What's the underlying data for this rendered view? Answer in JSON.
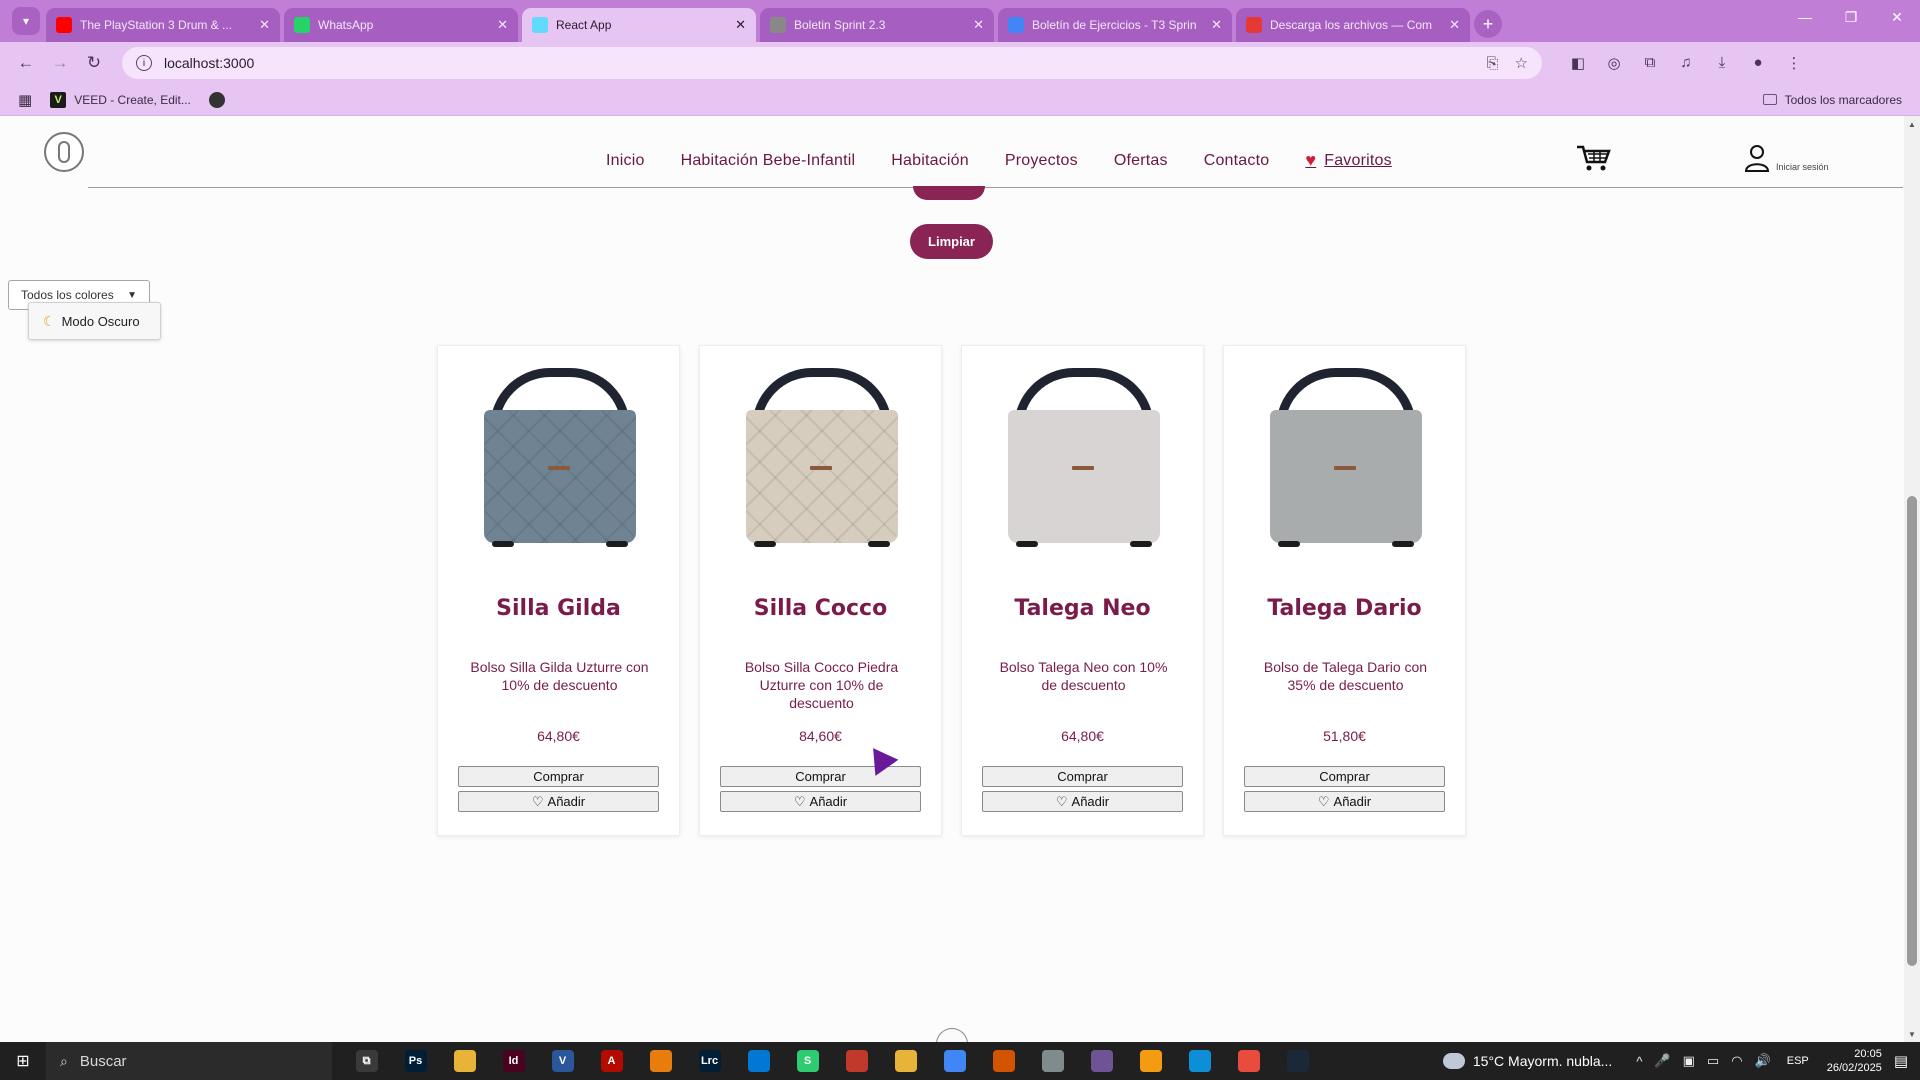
{
  "browser": {
    "tabs": [
      {
        "title": "The PlayStation 3 Drum & ...",
        "color": "#ff0000",
        "active": false
      },
      {
        "title": "WhatsApp",
        "color": "#25d366",
        "active": false
      },
      {
        "title": "React App",
        "color": "#61dafb",
        "active": true
      },
      {
        "title": "Boletin Sprint 2.3",
        "color": "#888888",
        "active": false
      },
      {
        "title": "Boletín de Ejercicios - T3 Sprin",
        "color": "#4285f4",
        "active": false
      },
      {
        "title": "Descarga los archivos — Com",
        "color": "#e53935",
        "active": false
      }
    ],
    "new_tab_glyph": "+",
    "close_glyph": "✕",
    "window_controls": [
      "—",
      "❐",
      "✕"
    ],
    "url": "localhost:3000",
    "bookmarks": {
      "apps_icon": "apps-grid-icon",
      "items": [
        {
          "label": "VEED - Create, Edit...",
          "icon_text": "V"
        }
      ],
      "all_label": "Todos los marcadores"
    }
  },
  "site": {
    "nav": [
      "Inicio",
      "Habitación Bebe-Infantil",
      "Habitación",
      "Proyectos",
      "Ofertas",
      "Contacto"
    ],
    "favorites_label": "Favoritos",
    "login_label": "Iniciar sesión",
    "clear_button": "Limpiar",
    "color_filter": {
      "selected": "Todos los colores"
    },
    "dark_mode_button": "Modo Oscuro",
    "accent_color": "#8a2454",
    "products": [
      {
        "name": "Silla Gilda",
        "description": "Bolso Silla Gilda Uzturre con 10% de descuento",
        "price": "64,80€",
        "buy_label": "Comprar",
        "fav_label": "Añadir",
        "bag_color": "#6f8392",
        "quilted": true
      },
      {
        "name": "Silla Cocco",
        "description": "Bolso Silla Cocco Piedra Uzturre con 10% de descuento",
        "price": "84,60€",
        "buy_label": "Comprar",
        "fav_label": "Añadir",
        "bag_color": "#d6cdbf",
        "quilted": true
      },
      {
        "name": "Talega Neo",
        "description": "Bolso Talega Neo con 10% de descuento",
        "price": "64,80€",
        "buy_label": "Comprar",
        "fav_label": "Añadir",
        "bag_color": "#d8d4d3",
        "quilted": false
      },
      {
        "name": "Talega Dario",
        "description": "Bolso de Talega Dario con 35% de descuento",
        "price": "51,80€",
        "buy_label": "Comprar",
        "fav_label": "Añadir",
        "bag_color": "#a9acad",
        "quilted": false
      }
    ]
  },
  "taskbar": {
    "search_placeholder": "Buscar",
    "apps": [
      {
        "name": "task-view",
        "label": "⧉",
        "color": "#3a3a3a"
      },
      {
        "name": "photoshop",
        "label": "Ps",
        "color": "#001e36"
      },
      {
        "name": "file-explorer",
        "label": "",
        "color": "#e8b339"
      },
      {
        "name": "indesign",
        "label": "Id",
        "color": "#49021f"
      },
      {
        "name": "visio",
        "label": "V",
        "color": "#2b579a"
      },
      {
        "name": "acrobat",
        "label": "A",
        "color": "#b30b00"
      },
      {
        "name": "blender",
        "label": "",
        "color": "#e87d0d"
      },
      {
        "name": "lightroom",
        "label": "Lrc",
        "color": "#001e36"
      },
      {
        "name": "vscode",
        "label": "",
        "color": "#0078d4"
      },
      {
        "name": "app-s",
        "label": "S",
        "color": "#2ecc71"
      },
      {
        "name": "app-grid",
        "label": "",
        "color": "#c0392b"
      },
      {
        "name": "app-note",
        "label": "",
        "color": "#e8b339"
      },
      {
        "name": "chrome",
        "label": "",
        "color": "#4285f4"
      },
      {
        "name": "app-color",
        "label": "",
        "color": "#d35400"
      },
      {
        "name": "app-mouse",
        "label": "",
        "color": "#7f8c8d"
      },
      {
        "name": "github",
        "label": "",
        "color": "#6e5494"
      },
      {
        "name": "app-orange",
        "label": "",
        "color": "#f39c12"
      },
      {
        "name": "edge",
        "label": "",
        "color": "#0c8fd6"
      },
      {
        "name": "app-red",
        "label": "",
        "color": "#e74c3c"
      },
      {
        "name": "app-steam",
        "label": "",
        "color": "#1b2838"
      }
    ],
    "weather": "15°C  Mayorm. nubla...",
    "tray_symbols": [
      "^",
      "🎤",
      "▣",
      "▭",
      "◠",
      "🔊"
    ],
    "lang": "ESP",
    "time": "20:05",
    "date": "26/02/2025"
  }
}
